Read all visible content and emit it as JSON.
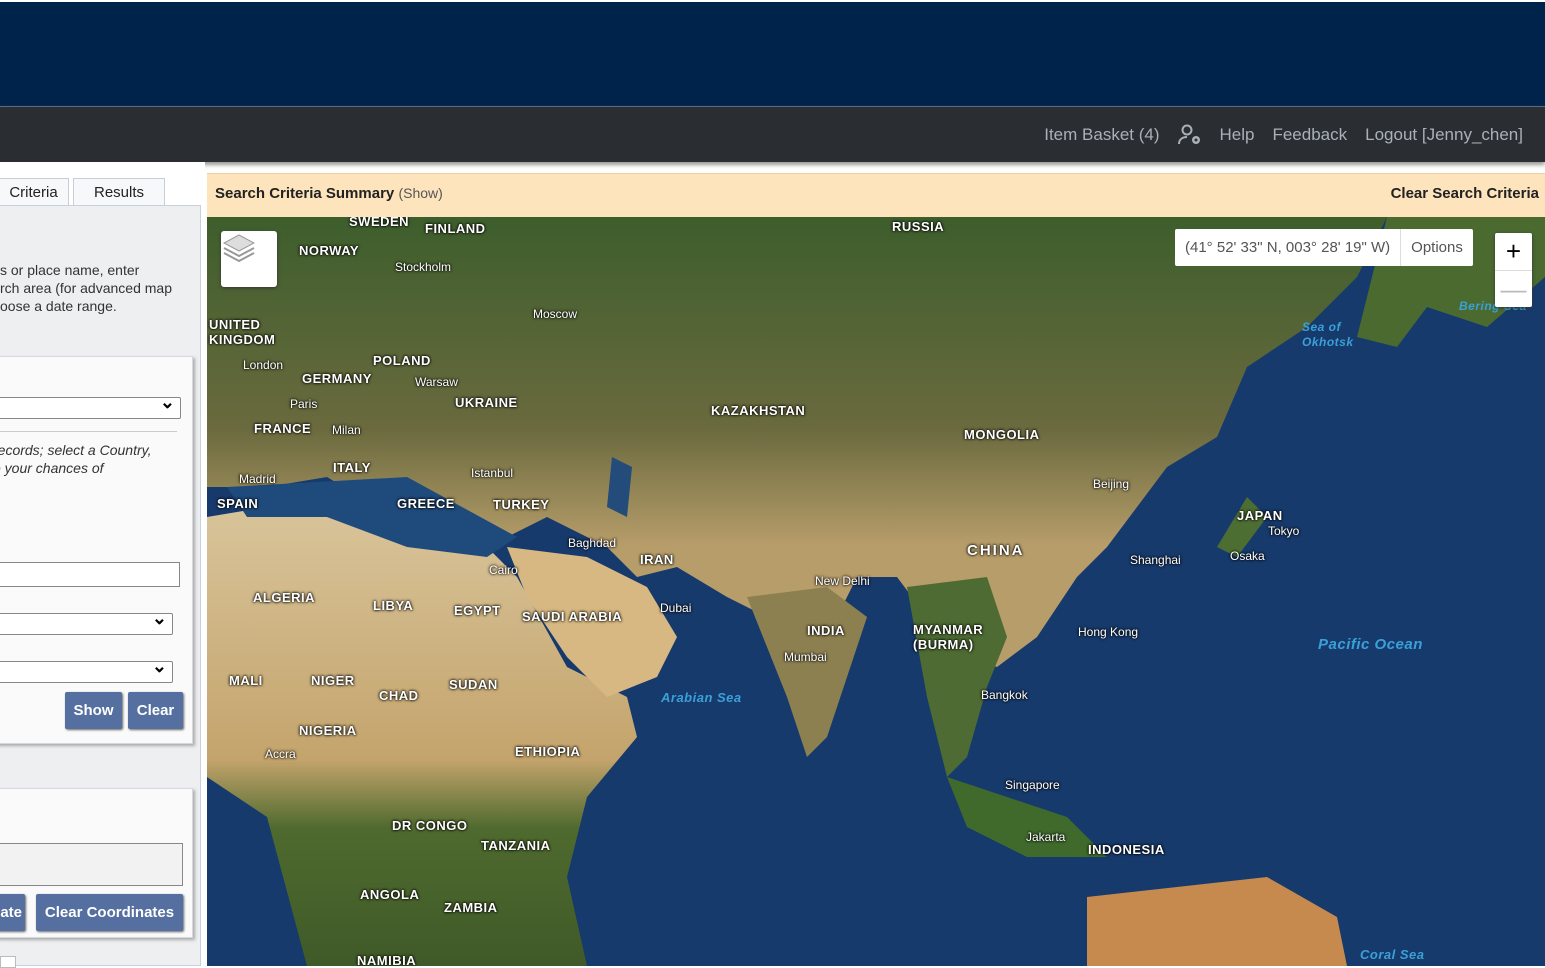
{
  "nav": {
    "item_basket": "Item Basket (4)",
    "help": "Help",
    "feedback": "Feedback",
    "logout": "Logout [Jenny_chen]"
  },
  "sidebar": {
    "tabs": [
      "Criteria",
      "Results"
    ],
    "intro": [
      "s or place name, enter",
      "rch area (for advanced map",
      "oose a date range."
    ],
    "hint": [
      "records; select a Country,",
      "e your chances of"
    ],
    "show": "Show",
    "clear": "Clear",
    "locate": "ate",
    "clear_coordinates": "Clear Coordinates"
  },
  "summary": {
    "title": "Search Criteria Summary",
    "show": "(Show)",
    "clear": "Clear Search Criteria"
  },
  "map": {
    "coordinates": "(41° 52' 33\" N, 003° 28' 19\" W)",
    "options": "Options",
    "zoom_in": "+",
    "zoom_out": "—",
    "labels": [
      "RUSSIA",
      "FINLAND",
      "SWEDEN",
      "NORWAY",
      "Stockholm",
      "Moscow",
      "UNITED KINGDOM",
      "London",
      "POLAND",
      "GERMANY",
      "Warsaw",
      "UKRAINE",
      "Paris",
      "FRANCE",
      "Milan",
      "ITALY",
      "Madrid",
      "SPAIN",
      "Istanbul",
      "GREECE",
      "TURKEY",
      "KAZAKHSTAN",
      "MONGOLIA",
      "Beijing",
      "JAPAN",
      "Tokyo",
      "Osaka",
      "Shanghai",
      "CHINA",
      "Baghdad",
      "IRAN",
      "Cairo",
      "New Delhi",
      "ALGERIA",
      "LIBYA",
      "EGYPT",
      "SAUDI ARABIA",
      "Dubai",
      "INDIA",
      "MYANMAR (BURMA)",
      "Hong Kong",
      "Mumbai",
      "MALI",
      "NIGER",
      "CHAD",
      "SUDAN",
      "Bangkok",
      "NIGERIA",
      "Accra",
      "ETHIOPIA",
      "Singapore",
      "DR CONGO",
      "TANZANIA",
      "Jakarta",
      "INDONESIA",
      "ANGOLA",
      "ZAMBIA",
      "NAMIBIA"
    ],
    "seas": [
      "Sea of Okhotsk",
      "Bering Sea",
      "Pacific Ocean",
      "Arabian Sea",
      "Coral Sea"
    ]
  }
}
